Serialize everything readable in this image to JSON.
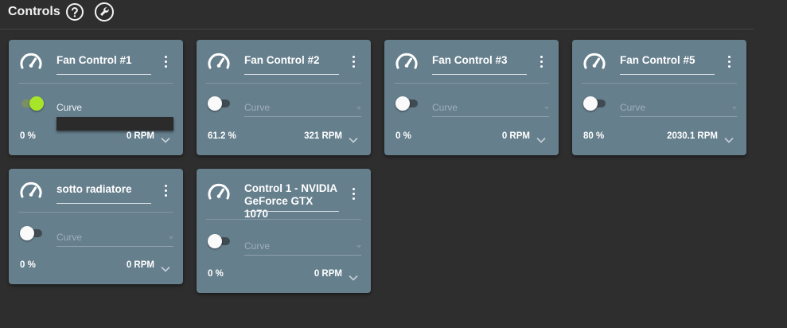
{
  "header": {
    "title": "Controls",
    "help_icon": "help-circle-icon",
    "settings_icon": "wrench-icon"
  },
  "colors": {
    "background": "#2e2e2e",
    "card": "#667f8d",
    "toggle_on": "#a6e52a",
    "dropdown_panel": "#2b2b2b"
  },
  "controls": [
    {
      "name": "Fan Control #1",
      "enabled": true,
      "mode_placeholder": "Curve",
      "percent": "0 %",
      "rpm": "0 RPM",
      "dropdown_open": true
    },
    {
      "name": "Fan Control #2",
      "enabled": false,
      "mode_placeholder": "Curve",
      "percent": "61.2 %",
      "rpm": "321 RPM"
    },
    {
      "name": "Fan Control #3",
      "enabled": false,
      "mode_placeholder": "Curve",
      "percent": "0 %",
      "rpm": "0 RPM"
    },
    {
      "name": "Fan Control #5",
      "enabled": false,
      "mode_placeholder": "Curve",
      "percent": "80 %",
      "rpm": "2030.1 RPM"
    },
    {
      "name": "sotto radiatore",
      "enabled": false,
      "mode_placeholder": "Curve",
      "percent": "0 %",
      "rpm": "0 RPM"
    },
    {
      "name": "Control 1 - NVIDIA GeForce GTX 1070",
      "enabled": false,
      "mode_placeholder": "Curve",
      "percent": "0 %",
      "rpm": "0 RPM"
    }
  ]
}
